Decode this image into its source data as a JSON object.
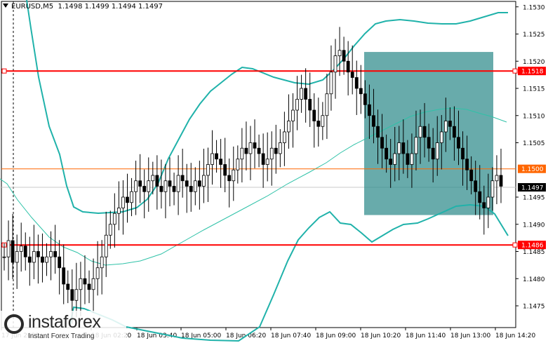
{
  "header": {
    "symbol": "EURUSD,M5",
    "quote": "1.1498 1.1499 1.1494 1.1497"
  },
  "price_axis": {
    "ticks": [
      "1.1530",
      "1.1525",
      "1.1520",
      "1.1515",
      "1.1510",
      "1.1505",
      "1.1495",
      "1.1490",
      "1.1485",
      "1.1480",
      "1.1475"
    ]
  },
  "time_axis": {
    "labels": [
      "17 Jun 2020",
      "18 Jun 02:20",
      "18 Jun 03:40",
      "18 Jun 05:00",
      "18 Jun 06:20",
      "18 Jun 07:40",
      "18 Jun 09:00",
      "18 Jun 10:20",
      "18 Jun 11:40",
      "18 Jun 13:00",
      "18 Jun 14:20"
    ]
  },
  "levels": [
    {
      "name": "resistance",
      "price": "1.1518",
      "color": "#ff0000"
    },
    {
      "name": "mid",
      "price": "1.1500",
      "color": "#ff6600"
    },
    {
      "name": "support",
      "price": "1.1486",
      "color": "#ff0000"
    }
  ],
  "current_price": {
    "label": "1.1497",
    "color": "#000000"
  },
  "colors": {
    "bands": "#20b2aa",
    "ma": "#2fc2a8",
    "box": "#2e8b8b",
    "candles": "#000000"
  },
  "logo": {
    "name": "instaforex",
    "tagline": "Instant Forex Trading"
  },
  "chart_data": {
    "type": "candlestick",
    "series_close": [
      1.1484,
      1.1487,
      1.1483,
      1.1485,
      1.1486,
      1.1484,
      1.1483,
      1.1485,
      1.1484,
      1.1483,
      1.1484,
      1.1485,
      1.1484,
      1.1482,
      1.1479,
      1.1478,
      1.1476,
      1.1478,
      1.148,
      1.1479,
      1.1478,
      1.148,
      1.1482,
      1.1484,
      1.1488,
      1.149,
      1.1492,
      1.1493,
      1.1495,
      1.1494,
      1.1496,
      1.1498,
      1.1497,
      1.1496,
      1.1498,
      1.1499,
      1.1497,
      1.1496,
      1.1498,
      1.1497,
      1.1496,
      1.1499,
      1.1498,
      1.1497,
      1.1496,
      1.1498,
      1.1497,
      1.1499,
      1.1501,
      1.1503,
      1.1502,
      1.1501,
      1.1499,
      1.1498,
      1.15,
      1.1502,
      1.1504,
      1.1503,
      1.1505,
      1.1504,
      1.1503,
      1.1501,
      1.1502,
      1.1504,
      1.1503,
      1.1505,
      1.1507,
      1.1509,
      1.1511,
      1.1513,
      1.1515,
      1.1513,
      1.1511,
      1.1509,
      1.1508,
      1.151,
      1.1514,
      1.1518,
      1.1521,
      1.1522,
      1.152,
      1.1518,
      1.1517,
      1.1515,
      1.1514,
      1.1512,
      1.151,
      1.1508,
      1.1506,
      1.1504,
      1.1502,
      1.1501,
      1.1503,
      1.1505,
      1.1503,
      1.1501,
      1.1503,
      1.1506,
      1.1508,
      1.1506,
      1.1504,
      1.1502,
      1.1505,
      1.1507,
      1.1509,
      1.1508,
      1.1506,
      1.1504,
      1.1502,
      1.15,
      1.1498,
      1.1496,
      1.1494,
      1.1493,
      1.1495,
      1.1498,
      1.1499,
      1.1497
    ],
    "ylim": [
      1.1471,
      1.1531
    ]
  }
}
